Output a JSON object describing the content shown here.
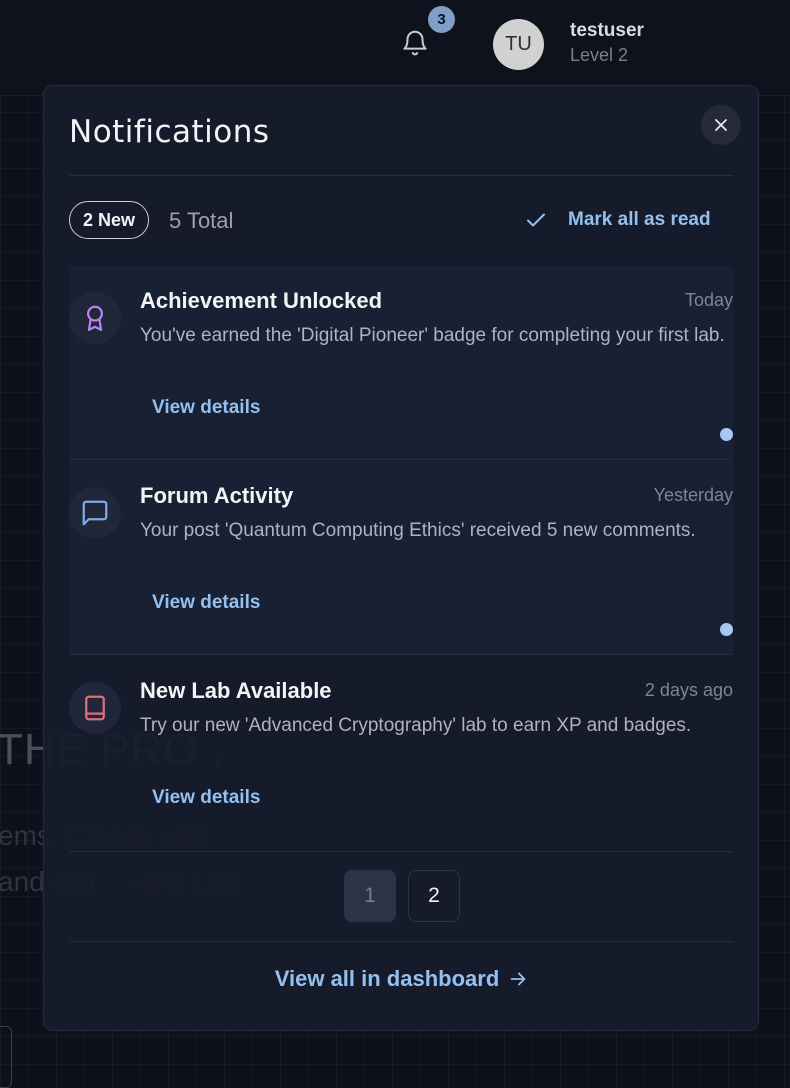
{
  "header": {
    "notification_count": "3",
    "user": {
      "initials": "TU",
      "name": "testuser",
      "level": "Level 2"
    }
  },
  "background": {
    "headline": "THE PRO .",
    "line1": "ems. Create with",
    "line2": "and self — one Lab"
  },
  "panel": {
    "title": "Notifications",
    "new_count": "2 New",
    "total_count": "5 Total",
    "mark_all_read": "Mark all as read",
    "notifications": [
      {
        "title": "Achievement Unlocked",
        "time": "Today",
        "message": "You've earned the 'Digital Pioneer' badge for completing your first lab.",
        "link": "View details",
        "unread": true,
        "icon": "award-icon",
        "icon_color": "#b784f2"
      },
      {
        "title": "Forum Activity",
        "time": "Yesterday",
        "message": "Your post 'Quantum Computing Ethics' received 5 new comments.",
        "link": "View details",
        "unread": true,
        "icon": "message-square-icon",
        "icon_color": "#7ea9ec"
      },
      {
        "title": "New Lab Available",
        "time": "2 days ago",
        "message": "Try our new 'Advanced Cryptography' lab to earn XP and badges.",
        "link": "View details",
        "unread": false,
        "icon": "book-icon",
        "icon_color": "#e06c7c"
      }
    ],
    "pagination": {
      "pages": [
        "1",
        "2"
      ],
      "current": "1"
    },
    "view_all": "View all in dashboard"
  },
  "colors": {
    "accent_link": "#93c0f0",
    "unread_dot": "#a6c8f5",
    "badge": "#7f9fc7",
    "panel_bg": "#171c2c"
  }
}
